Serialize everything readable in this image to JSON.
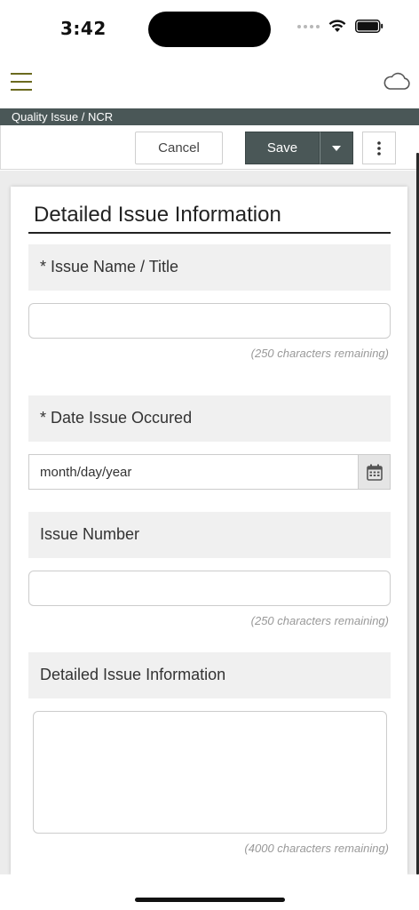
{
  "status_bar": {
    "time": "3:42"
  },
  "header": {
    "breadcrumb": "Quality Issue / NCR"
  },
  "toolbar": {
    "cancel_label": "Cancel",
    "save_label": "Save"
  },
  "form": {
    "section_title": "Detailed Issue Information",
    "fields": [
      {
        "label": "* Issue Name / Title",
        "value": "",
        "remaining": "(250 characters remaining)"
      },
      {
        "label": "* Date Issue Occured",
        "placeholder": "month/day/year"
      },
      {
        "label": "Issue Number",
        "value": "",
        "remaining": "(250 characters remaining)"
      },
      {
        "label": "Detailed Issue Information",
        "value": "",
        "remaining": "(4000 characters remaining)"
      }
    ]
  },
  "icons": [
    "menu-icon",
    "cloud-icon",
    "caret-down-icon",
    "more-vertical-icon",
    "calendar-icon",
    "wifi-icon",
    "battery-icon",
    "signal-icon"
  ],
  "colors": {
    "accent_dark": "#4a5757",
    "menu_olive": "#6b6a1e"
  }
}
